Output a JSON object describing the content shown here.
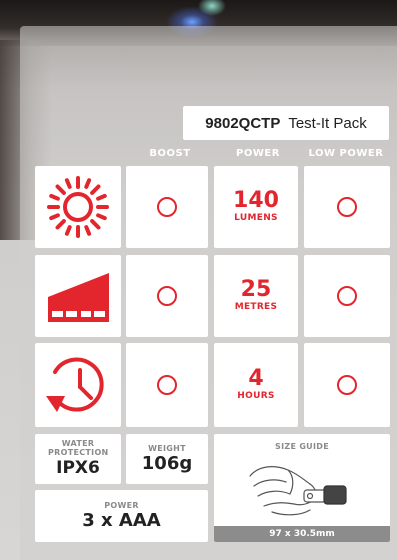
{
  "product": {
    "code": "9802QCTP",
    "name": "Test-It Pack"
  },
  "columns": [
    "BOOST",
    "POWER",
    "LOW POWER"
  ],
  "rows": [
    {
      "icon": "sun-icon",
      "value": "140",
      "unit": "LUMENS"
    },
    {
      "icon": "beam-distance-icon",
      "value": "25",
      "unit": "METRES"
    },
    {
      "icon": "clock-icon",
      "value": "4",
      "unit": "HOURS"
    }
  ],
  "specs": {
    "water": {
      "label": "WATER PROTECTION",
      "value": "IPX6"
    },
    "weight": {
      "label": "WEIGHT",
      "value": "106g"
    },
    "power": {
      "label": "POWER",
      "value": "3 x AAA"
    },
    "size": {
      "label": "SIZE GUIDE",
      "dims": "97 x 30.5mm"
    }
  },
  "colors": {
    "accent": "#e3252d",
    "panel": "#ffffff",
    "dims_bar": "#8c8c8c"
  }
}
